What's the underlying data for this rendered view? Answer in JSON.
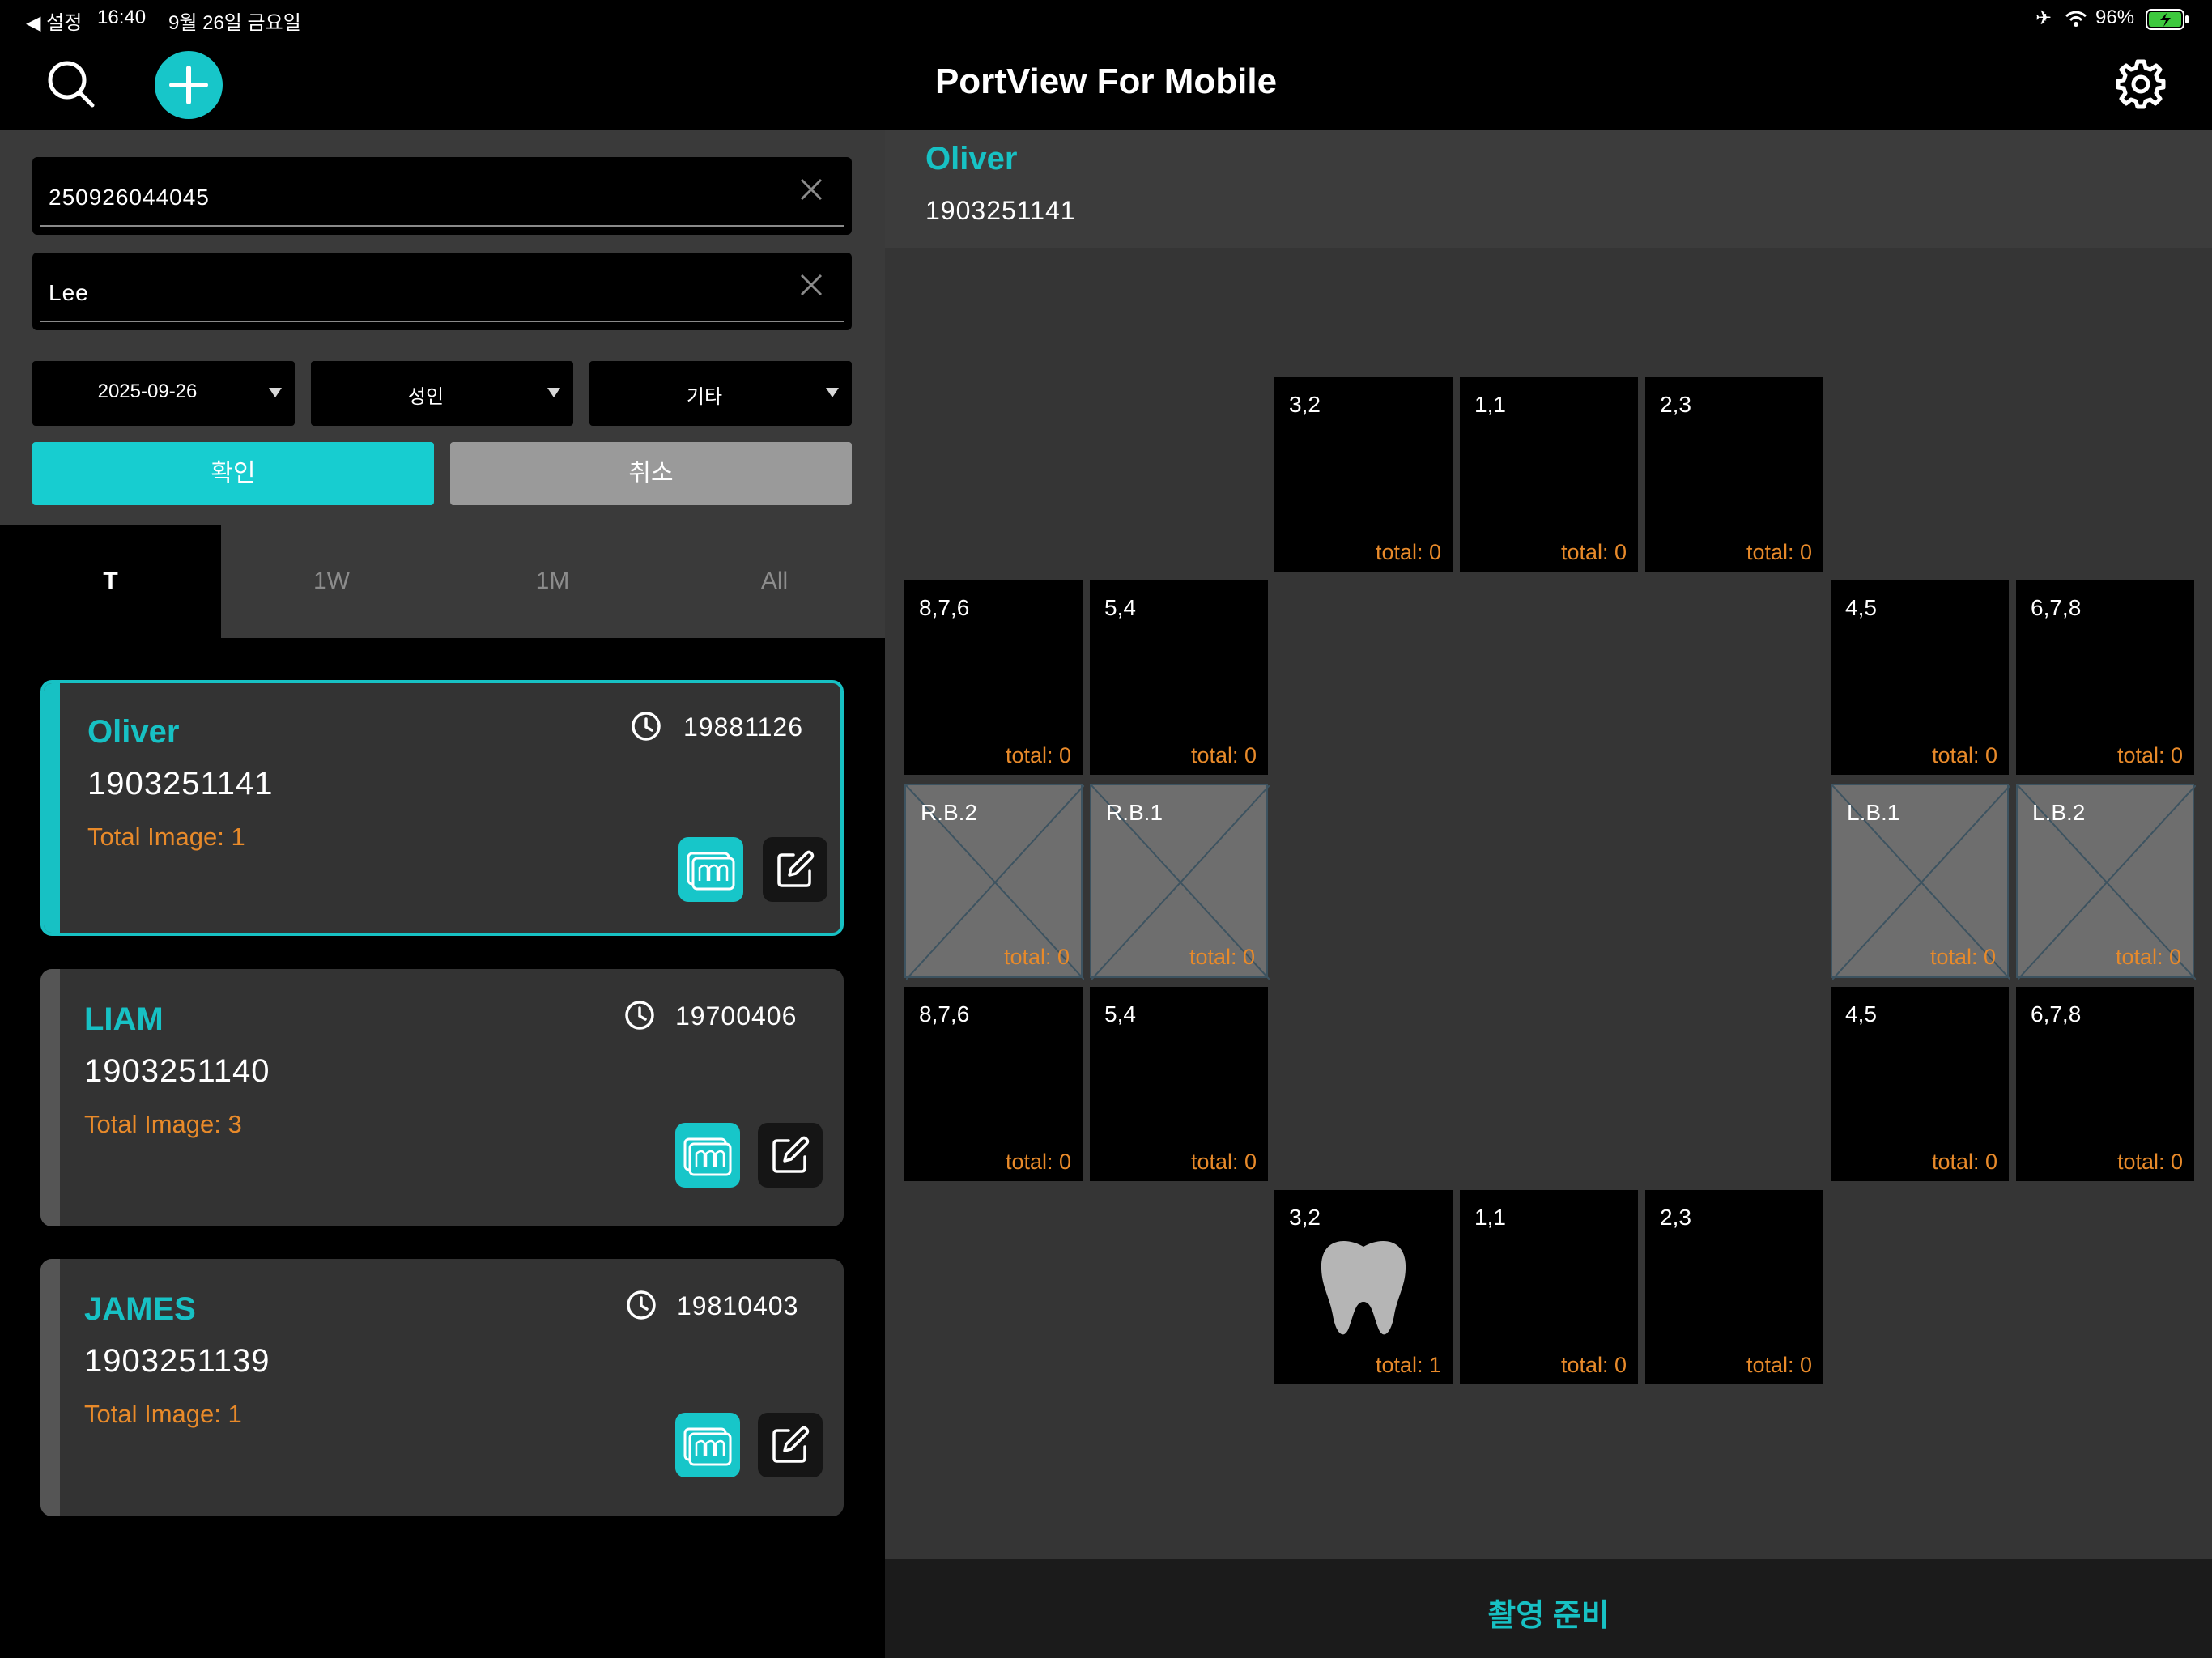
{
  "status_bar": {
    "back_label": "◀ 설정",
    "time": "16:40",
    "date": "9월 26일 금요일",
    "battery": "96%"
  },
  "header": {
    "title": "PortView For Mobile",
    "search_icon": "search-icon",
    "add_icon": "plus-circle-icon",
    "settings_icon": "gear-icon",
    "accent_color": "#17c1c4"
  },
  "form": {
    "id_value": "250926044045",
    "name_value": "Lee",
    "date_value": "2025-09-26",
    "age_value": "성인",
    "type_value": "기타",
    "confirm_label": "확인",
    "cancel_label": "취소"
  },
  "tabs": [
    "T",
    "1W",
    "1M",
    "All"
  ],
  "patients": [
    {
      "name": "Oliver",
      "id": "1903251141",
      "dob": "19881126",
      "total": "Total Image: 1"
    },
    {
      "name": "LIAM",
      "id": "1903251140",
      "dob": "19700406",
      "total": "Total Image: 3"
    },
    {
      "name": "JAMES",
      "id": "1903251139",
      "dob": "19810403",
      "total": "Total Image: 1"
    }
  ],
  "selected": {
    "name": "Oliver",
    "id": "1903251141"
  },
  "tiles": {
    "upper_front": [
      {
        "label": "3,2",
        "total": "total: 0"
      },
      {
        "label": "1,1",
        "total": "total: 0"
      },
      {
        "label": "2,3",
        "total": "total: 0"
      }
    ],
    "upper_right_side": [
      {
        "label": "8,7,6",
        "total": "total: 0"
      },
      {
        "label": "5,4",
        "total": "total: 0"
      }
    ],
    "upper_left_side": [
      {
        "label": "4,5",
        "total": "total: 0"
      },
      {
        "label": "6,7,8",
        "total": "total: 0"
      }
    ],
    "bitewing_right": [
      {
        "label": "R.B.2",
        "total": "total: 0"
      },
      {
        "label": "R.B.1",
        "total": "total: 0"
      }
    ],
    "bitewing_left": [
      {
        "label": "L.B.1",
        "total": "total: 0"
      },
      {
        "label": "L.B.2",
        "total": "total: 0"
      }
    ],
    "lower_right_side": [
      {
        "label": "8,7,6",
        "total": "total: 0"
      },
      {
        "label": "5,4",
        "total": "total: 0"
      }
    ],
    "lower_left_side": [
      {
        "label": "4,5",
        "total": "total: 0"
      },
      {
        "label": "6,7,8",
        "total": "total: 0"
      }
    ],
    "lower_front": [
      {
        "label": "3,2",
        "total": "total: 1",
        "icon": "tooth-icon"
      },
      {
        "label": "1,1",
        "total": "total: 0"
      },
      {
        "label": "2,3",
        "total": "total: 0"
      }
    ]
  },
  "capture_label": "촬영 준비"
}
